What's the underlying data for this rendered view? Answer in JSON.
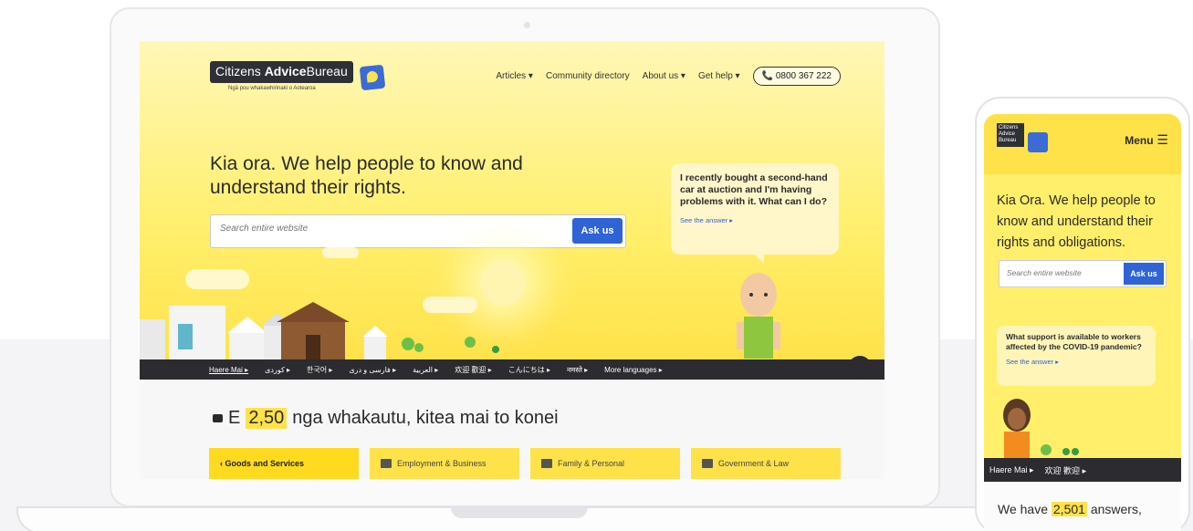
{
  "desktop": {
    "logo": {
      "text_normal": "Citizens",
      "text_bold": "Advice",
      "text_tail": "Bureau",
      "tagline": "Ngā pou whakawhirinaki o Aotearoa"
    },
    "nav": {
      "articles": "Articles",
      "community": "Community directory",
      "about": "About us",
      "help": "Get help",
      "phone": "📞 0800 367 222"
    },
    "hero": {
      "title": "Kia ora. We help people to know and understand their rights.",
      "search_placeholder": "Search entire website",
      "ask_label": "Ask us"
    },
    "bubble": {
      "question": "I recently bought a second-hand car at auction and I'm having problems with it. What can I do?",
      "link": "See the answer ▸"
    },
    "languages": [
      "Haere Mai",
      "کوردی",
      "한국어",
      "فارسی و دری",
      "العربية",
      "欢迎 歡迎",
      "こんにちは",
      "नमस्ते",
      "More languages"
    ],
    "answers": {
      "prefix": "E",
      "count": "2,50",
      "suffix": "nga whakautu, kitea mai to konei"
    },
    "categories": [
      "‹ Goods and Services",
      "Employment & Business",
      "Family & Personal",
      "Government & Law"
    ]
  },
  "mobile": {
    "logo": {
      "text": "Citizens Advice Bureau"
    },
    "menu_label": "Menu",
    "title": "Kia Ora. We help people to know and understand their rights and obligations.",
    "search_placeholder": "Search entire website",
    "ask_label": "Ask us",
    "bubble": {
      "question": "What support is available to workers affected by the COVID-19 pandemic?",
      "link": "See the answer ▸"
    },
    "languages": [
      "Haere Mai",
      "欢迎 歡迎"
    ],
    "answers": {
      "prefix": "We have",
      "count": "2,501",
      "suffix": "answers,"
    }
  },
  "colors": {
    "brand_yellow": "#ffe24a",
    "accent_blue": "#2f63d6",
    "dark": "#2b2b30"
  }
}
